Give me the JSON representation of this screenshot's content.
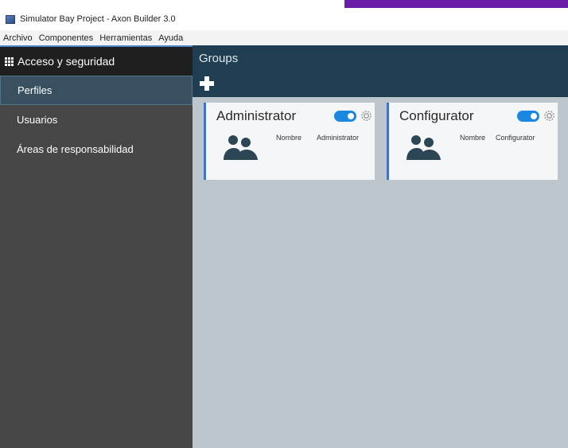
{
  "window": {
    "title": "Simulator Bay Project - Axon Builder 3.0"
  },
  "menu": {
    "items": [
      "Archivo",
      "Componentes",
      "Herramientas",
      "Ayuda"
    ]
  },
  "sidebar": {
    "header": "Acceso y seguridad",
    "items": [
      {
        "label": "Perfiles",
        "active": true
      },
      {
        "label": "Usuarios",
        "active": false
      },
      {
        "label": "Áreas de responsabilidad",
        "active": false
      }
    ]
  },
  "main": {
    "title": "Groups",
    "cards": [
      {
        "title": "Administrator",
        "field_label": "Nombre",
        "field_value": "Administrator",
        "enabled": true
      },
      {
        "title": "Configurator",
        "field_label": "Nombre",
        "field_value": "Configurator",
        "enabled": true
      }
    ]
  },
  "colors": {
    "sidebar_bg": "#464646",
    "sidebar_header_bg": "#1f1f1f",
    "main_header_bg": "#1f3e52",
    "main_bg": "#bcc6cc",
    "toggle_on": "#1a88e0",
    "card_accent": "#4472c4"
  },
  "icons": [
    "app-icon",
    "grid-icon",
    "add-icon",
    "toggle-icon",
    "gear-icon",
    "users-icon"
  ]
}
